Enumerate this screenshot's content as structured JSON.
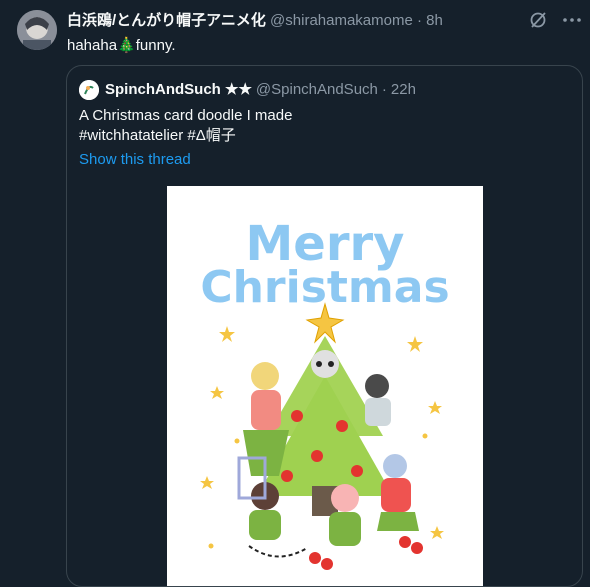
{
  "tweet": {
    "author_name": "白浜鴎/とんがり帽子アニメ化",
    "handle": "@shirahamakamome",
    "separator": "·",
    "time": "8h",
    "text_prefix": "hahaha",
    "text_emoji": "🎄",
    "text_suffix": "funny."
  },
  "icons": {
    "grok": "grok-icon",
    "more": "more-icon"
  },
  "quote": {
    "author_name": "SpinchAndSuch ★★",
    "handle": "@SpinchAndSuch",
    "separator": "·",
    "time": "22h",
    "line1": "A Christmas card doodle I made",
    "line2": "#witchhatatelier #Δ帽子",
    "show_thread": "Show this thread"
  },
  "image": {
    "title_line1": "Merry",
    "title_line2": "Christmas"
  },
  "colors": {
    "background": "#15202b",
    "link": "#1d9bf0",
    "muted": "#8b98a5",
    "title_blue": "#8dc8f2"
  }
}
